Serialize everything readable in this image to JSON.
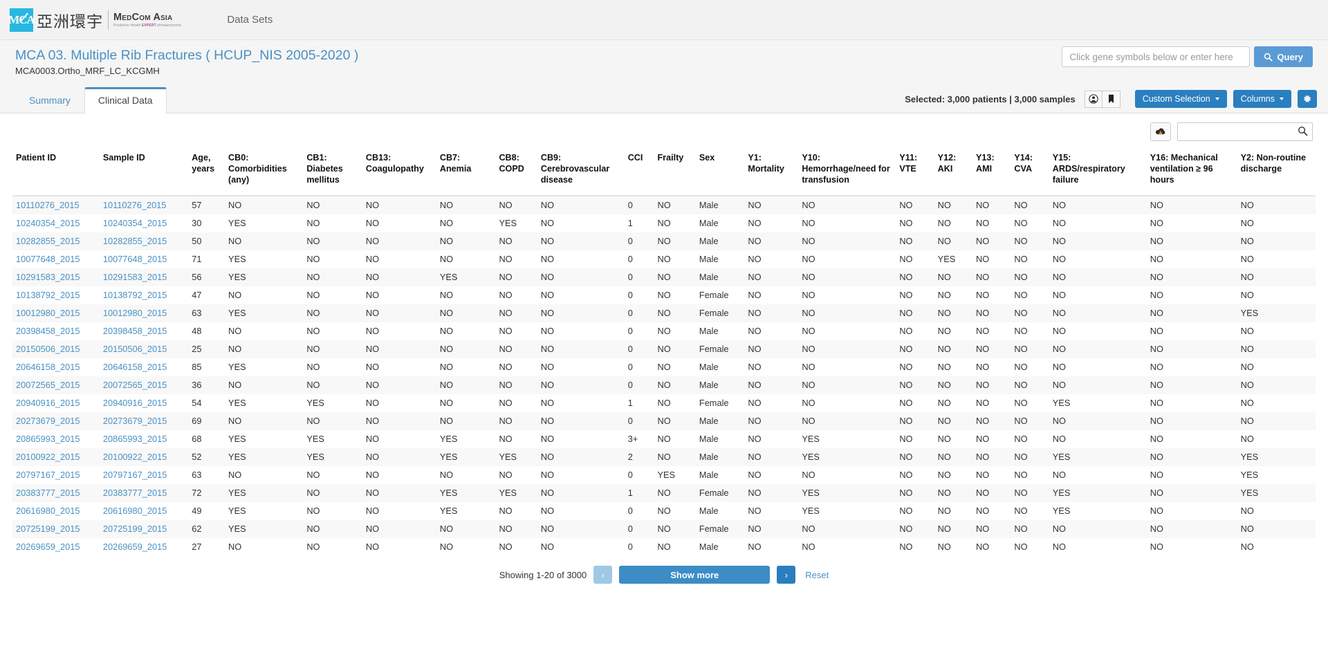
{
  "navbar": {
    "logo_mark": "MCA",
    "logo_cjk": "亞洲環宇",
    "logo_latin": "MedCom Asia",
    "logo_tagline_1": "Predictive Health",
    "logo_tagline_2": "EXPERT",
    "logo_tagline_3": "pHealumynotor",
    "links": [
      {
        "label": "Data Sets"
      }
    ]
  },
  "header": {
    "title": "MCA 03. Multiple Rib Fractures ( HCUP_NIS 2005-2020 )",
    "subtitle": "MCA0003.Ortho_MRF_LC_KCGMH",
    "query_placeholder": "Click gene symbols below or enter here",
    "query_value": "",
    "query_button": "Query"
  },
  "tabs": [
    {
      "label": "Summary",
      "active": false
    },
    {
      "label": "Clinical Data",
      "active": true
    }
  ],
  "toolbar": {
    "selected_text": "Selected: 3,000 patients | 3,000 samples",
    "patients_icon": "user-circle-icon",
    "bookmark_icon": "bookmark-icon",
    "custom_selection_label": "Custom Selection",
    "columns_label": "Columns",
    "gear_icon": "gear-icon"
  },
  "table_tools": {
    "download_icon": "cloud-download-icon",
    "search_placeholder": "",
    "search_value": "",
    "search_icon": "search-icon"
  },
  "table": {
    "columns": [
      "Patient ID",
      "Sample ID",
      "Age, years",
      "CB0: Comorbidities (any)",
      "CB1: Diabetes mellitus",
      "CB13: Coagulopathy",
      "CB7: Anemia",
      "CB8: COPD",
      "CB9: Cerebrovascular disease",
      "CCI",
      "Frailty",
      "Sex",
      "Y1: Mortality",
      "Y10: Hemorrhage/need for transfusion",
      "Y11: VTE",
      "Y12: AKI",
      "Y13: AMI",
      "Y14: CVA",
      "Y15: ARDS/respiratory failure",
      "Y16: Mechanical ventilation ≥ 96 hours",
      "Y2: Non-routine discharge"
    ],
    "rows": [
      [
        "10110276_2015",
        "10110276_2015",
        "57",
        "NO",
        "NO",
        "NO",
        "NO",
        "NO",
        "NO",
        "0",
        "NO",
        "Male",
        "NO",
        "NO",
        "NO",
        "NO",
        "NO",
        "NO",
        "NO",
        "NO",
        "NO"
      ],
      [
        "10240354_2015",
        "10240354_2015",
        "30",
        "YES",
        "NO",
        "NO",
        "NO",
        "YES",
        "NO",
        "1",
        "NO",
        "Male",
        "NO",
        "NO",
        "NO",
        "NO",
        "NO",
        "NO",
        "NO",
        "NO",
        "NO"
      ],
      [
        "10282855_2015",
        "10282855_2015",
        "50",
        "NO",
        "NO",
        "NO",
        "NO",
        "NO",
        "NO",
        "0",
        "NO",
        "Male",
        "NO",
        "NO",
        "NO",
        "NO",
        "NO",
        "NO",
        "NO",
        "NO",
        "NO"
      ],
      [
        "10077648_2015",
        "10077648_2015",
        "71",
        "YES",
        "NO",
        "NO",
        "NO",
        "NO",
        "NO",
        "0",
        "NO",
        "Male",
        "NO",
        "NO",
        "NO",
        "YES",
        "NO",
        "NO",
        "NO",
        "NO",
        "NO"
      ],
      [
        "10291583_2015",
        "10291583_2015",
        "56",
        "YES",
        "NO",
        "NO",
        "YES",
        "NO",
        "NO",
        "0",
        "NO",
        "Male",
        "NO",
        "NO",
        "NO",
        "NO",
        "NO",
        "NO",
        "NO",
        "NO",
        "NO"
      ],
      [
        "10138792_2015",
        "10138792_2015",
        "47",
        "NO",
        "NO",
        "NO",
        "NO",
        "NO",
        "NO",
        "0",
        "NO",
        "Female",
        "NO",
        "NO",
        "NO",
        "NO",
        "NO",
        "NO",
        "NO",
        "NO",
        "NO"
      ],
      [
        "10012980_2015",
        "10012980_2015",
        "63",
        "YES",
        "NO",
        "NO",
        "NO",
        "NO",
        "NO",
        "0",
        "NO",
        "Female",
        "NO",
        "NO",
        "NO",
        "NO",
        "NO",
        "NO",
        "NO",
        "NO",
        "YES"
      ],
      [
        "20398458_2015",
        "20398458_2015",
        "48",
        "NO",
        "NO",
        "NO",
        "NO",
        "NO",
        "NO",
        "0",
        "NO",
        "Male",
        "NO",
        "NO",
        "NO",
        "NO",
        "NO",
        "NO",
        "NO",
        "NO",
        "NO"
      ],
      [
        "20150506_2015",
        "20150506_2015",
        "25",
        "NO",
        "NO",
        "NO",
        "NO",
        "NO",
        "NO",
        "0",
        "NO",
        "Female",
        "NO",
        "NO",
        "NO",
        "NO",
        "NO",
        "NO",
        "NO",
        "NO",
        "NO"
      ],
      [
        "20646158_2015",
        "20646158_2015",
        "85",
        "YES",
        "NO",
        "NO",
        "NO",
        "NO",
        "NO",
        "0",
        "NO",
        "Male",
        "NO",
        "NO",
        "NO",
        "NO",
        "NO",
        "NO",
        "NO",
        "NO",
        "NO"
      ],
      [
        "20072565_2015",
        "20072565_2015",
        "36",
        "NO",
        "NO",
        "NO",
        "NO",
        "NO",
        "NO",
        "0",
        "NO",
        "Male",
        "NO",
        "NO",
        "NO",
        "NO",
        "NO",
        "NO",
        "NO",
        "NO",
        "NO"
      ],
      [
        "20940916_2015",
        "20940916_2015",
        "54",
        "YES",
        "YES",
        "NO",
        "NO",
        "NO",
        "NO",
        "1",
        "NO",
        "Female",
        "NO",
        "NO",
        "NO",
        "NO",
        "NO",
        "NO",
        "YES",
        "NO",
        "NO"
      ],
      [
        "20273679_2015",
        "20273679_2015",
        "69",
        "NO",
        "NO",
        "NO",
        "NO",
        "NO",
        "NO",
        "0",
        "NO",
        "Male",
        "NO",
        "NO",
        "NO",
        "NO",
        "NO",
        "NO",
        "NO",
        "NO",
        "NO"
      ],
      [
        "20865993_2015",
        "20865993_2015",
        "68",
        "YES",
        "YES",
        "NO",
        "YES",
        "NO",
        "NO",
        "3+",
        "NO",
        "Male",
        "NO",
        "YES",
        "NO",
        "NO",
        "NO",
        "NO",
        "NO",
        "NO",
        "NO"
      ],
      [
        "20100922_2015",
        "20100922_2015",
        "52",
        "YES",
        "YES",
        "NO",
        "YES",
        "YES",
        "NO",
        "2",
        "NO",
        "Male",
        "NO",
        "YES",
        "NO",
        "NO",
        "NO",
        "NO",
        "YES",
        "NO",
        "YES"
      ],
      [
        "20797167_2015",
        "20797167_2015",
        "63",
        "NO",
        "NO",
        "NO",
        "NO",
        "NO",
        "NO",
        "0",
        "YES",
        "Male",
        "NO",
        "NO",
        "NO",
        "NO",
        "NO",
        "NO",
        "NO",
        "NO",
        "YES"
      ],
      [
        "20383777_2015",
        "20383777_2015",
        "72",
        "YES",
        "NO",
        "NO",
        "YES",
        "YES",
        "NO",
        "1",
        "NO",
        "Female",
        "NO",
        "YES",
        "NO",
        "NO",
        "NO",
        "NO",
        "YES",
        "NO",
        "YES"
      ],
      [
        "20616980_2015",
        "20616980_2015",
        "49",
        "YES",
        "NO",
        "NO",
        "YES",
        "NO",
        "NO",
        "0",
        "NO",
        "Male",
        "NO",
        "YES",
        "NO",
        "NO",
        "NO",
        "NO",
        "YES",
        "NO",
        "NO"
      ],
      [
        "20725199_2015",
        "20725199_2015",
        "62",
        "YES",
        "NO",
        "NO",
        "NO",
        "NO",
        "NO",
        "0",
        "NO",
        "Female",
        "NO",
        "NO",
        "NO",
        "NO",
        "NO",
        "NO",
        "NO",
        "NO",
        "NO"
      ],
      [
        "20269659_2015",
        "20269659_2015",
        "27",
        "NO",
        "NO",
        "NO",
        "NO",
        "NO",
        "NO",
        "0",
        "NO",
        "Male",
        "NO",
        "NO",
        "NO",
        "NO",
        "NO",
        "NO",
        "NO",
        "NO",
        "NO"
      ]
    ]
  },
  "pager": {
    "showing_label": "Showing 1-20 of 3000",
    "prev_label": "‹",
    "show_more_label": "Show more",
    "next_label": "›",
    "reset_label": "Reset"
  },
  "colors": {
    "brand_cyan": "#27b7e0",
    "link_blue": "#4a90c4",
    "button_blue": "#2a7fbf",
    "query_blue": "#5b9bd5"
  }
}
